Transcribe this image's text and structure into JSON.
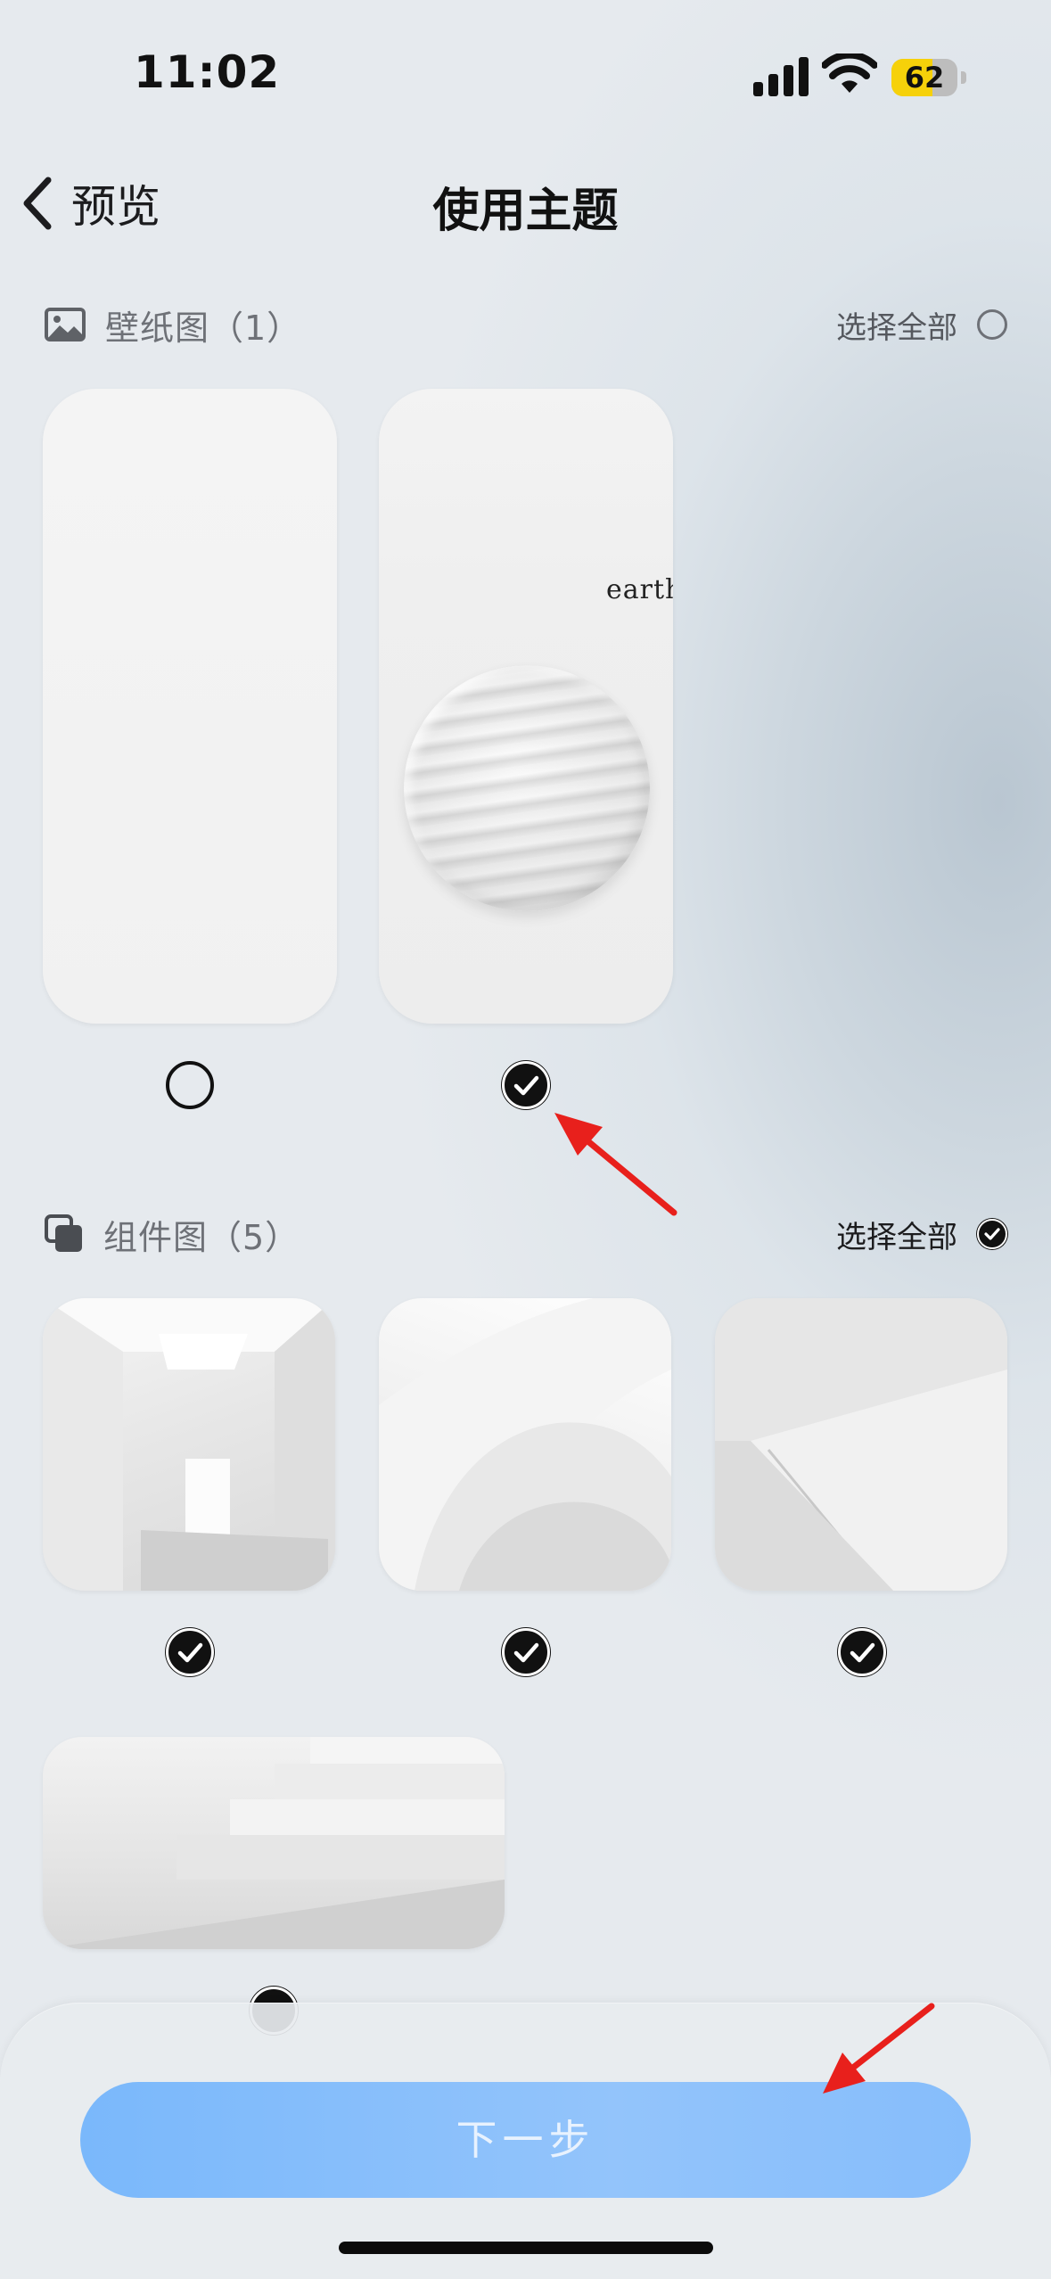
{
  "status_bar": {
    "time": "11:02",
    "battery_level": "62",
    "battery_fraction": 0.62,
    "battery_color": "#f6d10a"
  },
  "nav": {
    "back_label": "预览",
    "title": "使用主题"
  },
  "wallpaper_section": {
    "label": "壁纸图（1）",
    "select_all_label": "选择全部",
    "select_all_checked": false,
    "items": [
      {
        "selected": false
      },
      {
        "selected": true,
        "caption": "earth"
      }
    ]
  },
  "widget_section": {
    "label": "组件图（5）",
    "select_all_label": "选择全部",
    "select_all_checked": true,
    "items": [
      {
        "selected": true
      },
      {
        "selected": true
      },
      {
        "selected": true
      },
      {
        "selected": true
      }
    ]
  },
  "footer": {
    "next_label": "下一步",
    "accent_color": "#86bdfb"
  },
  "annotation_color": "#e8201c"
}
